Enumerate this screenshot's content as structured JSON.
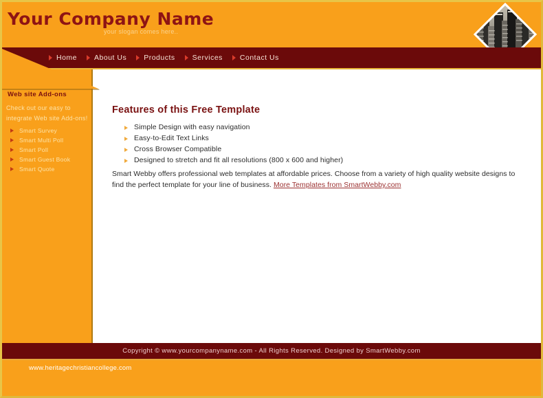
{
  "theme": {
    "orange": "#f9a01b",
    "dark_red": "#6b0a0a",
    "title_red": "#8e1414",
    "gold_border": "#e8c547",
    "link_red": "#9b3030",
    "cream_text": "#fde3a8"
  },
  "header": {
    "company_name": "Your Company Name",
    "slogan": "your slogan comes here..",
    "building_photo_alt": "skyscrapers-photo"
  },
  "nav": {
    "items": [
      {
        "label": "Home"
      },
      {
        "label": "About Us"
      },
      {
        "label": "Products"
      },
      {
        "label": "Services"
      },
      {
        "label": "Contact Us"
      }
    ]
  },
  "sidebar": {
    "title": "Web site Add-ons",
    "description": "Check out our easy to integrate Web site Add-ons!",
    "links": [
      {
        "label": "Smart Survey"
      },
      {
        "label": "Smart Multi Poll"
      },
      {
        "label": "Smart Poll"
      },
      {
        "label": "Smart Guest Book"
      },
      {
        "label": "Smart Quote"
      }
    ]
  },
  "main": {
    "heading": "Features of this Free Template",
    "features": [
      {
        "label": "Simple Design with easy navigation"
      },
      {
        "label": "Easy-to-Edit Text Links"
      },
      {
        "label": "Cross Browser Compatible"
      },
      {
        "label": "Designed to stretch and fit all resolutions (800 x 600 and higher)"
      }
    ],
    "intro_paragraph": "Smart Webby offers professional web templates at affordable prices. Choose from a variety of high quality website designs to find the perfect template for your line of business. ",
    "more_templates_link": "More Templates from SmartWebby.com"
  },
  "footer": {
    "copyright": "Copyright © www.yourcompanyname.com - All Rights Reserved. Designed by SmartWebby.com",
    "site_url": "www.heritagechristiancollege.com"
  }
}
